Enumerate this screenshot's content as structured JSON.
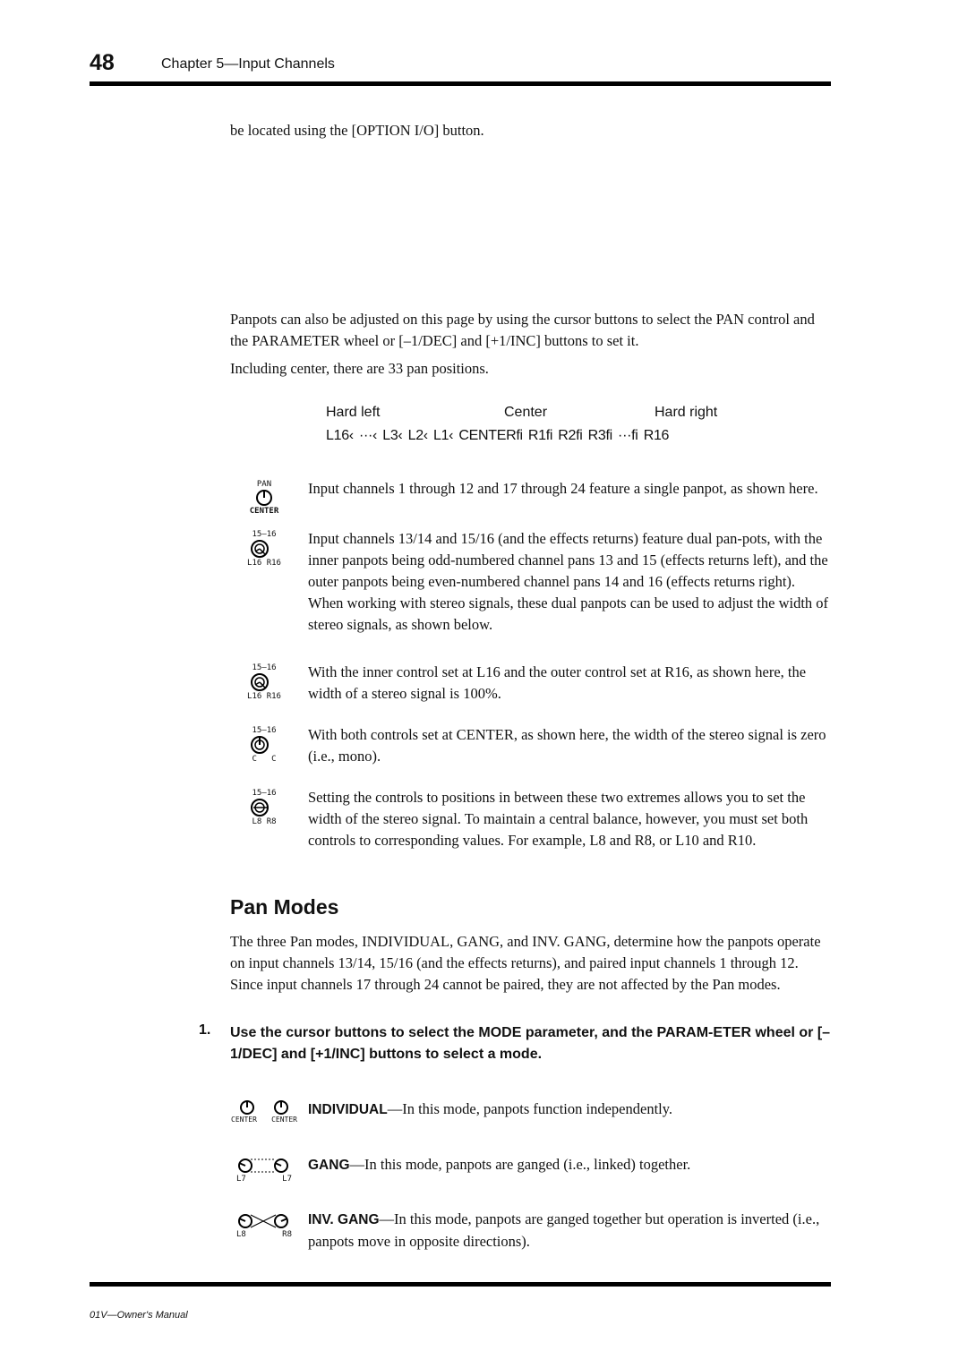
{
  "header": {
    "page_number": "48",
    "chapter": "Chapter 5—Input Channels"
  },
  "intro_line": "be located using the [OPTION I/O] button.",
  "panpot_para": "Panpots can also be adjusted on this page by using the cursor buttons to select the PAN control and the PARAMETER wheel or [–1/DEC] and [+1/INC] buttons to set it.",
  "positions_para": "Including center, there are 33 pan positions.",
  "pan_positions": {
    "hard_left": "Hard left",
    "center": "Center",
    "hard_right": "Hard right",
    "sequence": "L16‹  ···‹  L3‹  L2‹  L1‹  CENTERfi  R1fi  R2fi  R3fi  ···fi  R16"
  },
  "panpot_examples": [
    {
      "icon": "single-panpot-icon",
      "top_label": "PAN",
      "bottom_label": "CENTER",
      "texts": [
        "Input channels 1 through 12 and 17 through 24 feature a single panpot, as shown here."
      ]
    },
    {
      "icon": "dual-panpot-icon",
      "top_label": "15–16",
      "bottom_label": "L16 R16",
      "texts": [
        "Input channels 13/14 and 15/16 (and the effects returns) feature dual pan-pots, with the inner panpots being odd-numbered channel pans 13 and 15 (effects returns left), and the outer panpots being even-numbered channel pans 14 and 16 (effects returns right). When working with stereo signals, these dual panpots can be used to adjust the width of stereo signals, as shown below."
      ]
    },
    {
      "icon": "dual-panpot-full-width-icon",
      "top_label": "15–16",
      "bottom_label": "L16 R16",
      "texts": [
        "With the inner control set at L16 and the outer control set at R16, as shown here, the width of a stereo signal is 100%."
      ]
    },
    {
      "icon": "dual-panpot-mono-icon",
      "top_label": "15–16",
      "bottom_label": "C   C",
      "texts": [
        "With both controls set at CENTER, as shown here, the width of the stereo signal is zero (i.e., mono)."
      ]
    },
    {
      "icon": "dual-panpot-partial-width-icon",
      "top_label": "15–16",
      "bottom_label": "L8 R8",
      "texts": [
        "Setting the controls to positions in between these two extremes allows you to set the width of the stereo signal. To maintain a central balance, however, you must set both controls to corresponding values. For example, L8 and R8, or L10 and R10."
      ]
    }
  ],
  "section": {
    "title": "Pan Modes",
    "intro": "The three Pan modes, INDIVIDUAL, GANG, and INV. GANG, determine how the panpots operate on input channels 13/14, 15/16 (and the effects returns), and paired input channels 1 through 12. Since input channels 17 through 24 cannot be paired, they are not affected by the Pan modes.",
    "step_number": "1.",
    "step_text": "Use the cursor buttons to select the MODE parameter, and the PARAM-ETER wheel or [–1/DEC] and [+1/INC] buttons to select a mode.",
    "modes": [
      {
        "name": "INDIVIDUAL",
        "description": "—In this mode, panpots function independently.",
        "labels": [
          "CENTER",
          "CENTER"
        ]
      },
      {
        "name": "GANG",
        "description": "—In this mode, panpots are ganged (i.e., linked) together.",
        "labels": [
          "L7",
          "L7"
        ]
      },
      {
        "name": "INV. GANG",
        "description": "—In this mode, panpots are ganged together but operation is inverted (i.e., panpots move in opposite directions).",
        "labels": [
          "L8",
          "R8"
        ]
      }
    ]
  },
  "footer": {
    "manual_title": "01V—Owner's Manual"
  }
}
